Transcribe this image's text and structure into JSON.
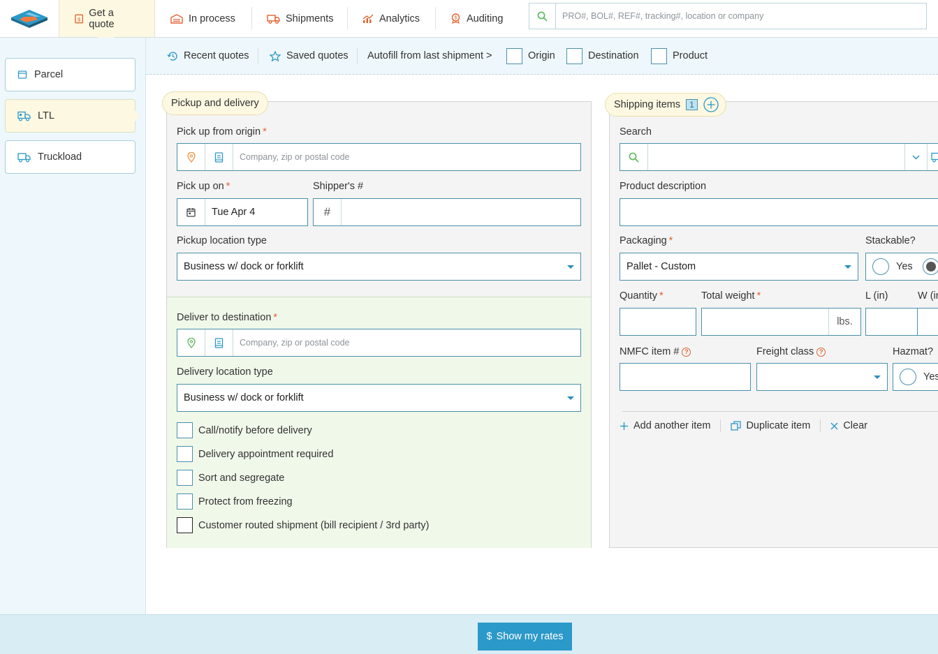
{
  "nav": {
    "tabs": [
      {
        "label": "Get a quote"
      },
      {
        "label": "In process"
      },
      {
        "label": "Shipments"
      },
      {
        "label": "Analytics"
      },
      {
        "label": "Auditing"
      }
    ],
    "search_placeholder": "PRO#, BOL#, REF#, tracking#, location or company"
  },
  "sidebar": {
    "modes": [
      {
        "label": "Parcel"
      },
      {
        "label": "LTL"
      },
      {
        "label": "Truckload"
      }
    ]
  },
  "subbar": {
    "recent": "Recent quotes",
    "saved": "Saved quotes",
    "autofill": "Autofill from last shipment >",
    "origin": "Origin",
    "destination": "Destination",
    "product": "Product"
  },
  "pickup": {
    "legend": "Pickup and delivery",
    "origin_label": "Pick up from origin",
    "origin_placeholder": "Company, zip or postal code",
    "pickup_on_label": "Pick up on",
    "pickup_date": "Tue Apr 4",
    "shipper_label": "Shipper's #",
    "hash": "#",
    "pickup_type_label": "Pickup location type",
    "pickup_type_value": "Business w/ dock or forklift",
    "deliver_label": "Deliver to destination",
    "deliver_placeholder": "Company, zip or postal code",
    "delivery_type_label": "Delivery location type",
    "delivery_type_value": "Business w/ dock or forklift",
    "options": [
      {
        "label": "Call/notify before delivery"
      },
      {
        "label": "Delivery appointment required"
      },
      {
        "label": "Sort and segregate"
      },
      {
        "label": "Protect from freezing"
      },
      {
        "label": "Customer routed shipment (bill recipient / 3rd party)"
      }
    ]
  },
  "items": {
    "legend": "Shipping items",
    "count": "1",
    "search_label": "Search",
    "product_desc_label": "Product description",
    "packaging_label": "Packaging",
    "packaging_value": "Pallet - Custom",
    "stackable_label": "Stackable?",
    "yes": "Yes",
    "quantity_label": "Quantity",
    "weight_label": "Total weight",
    "weight_unit": "lbs.",
    "length_label": "L (in)",
    "width_label": "W (ir",
    "nmfc_label": "NMFC item #",
    "class_label": "Freight class",
    "hazmat_label": "Hazmat?",
    "hazmat_yes": "Yes",
    "add_item": "Add another item",
    "duplicate": "Duplicate item",
    "clear": "Clear"
  },
  "footer": {
    "show_rates": "Show my rates",
    "currency": "$"
  },
  "colors": {
    "accent": "#2b99c9",
    "orange": "#e3622f",
    "green": "#5cb85c",
    "active_tab": "#fdf8e1"
  }
}
